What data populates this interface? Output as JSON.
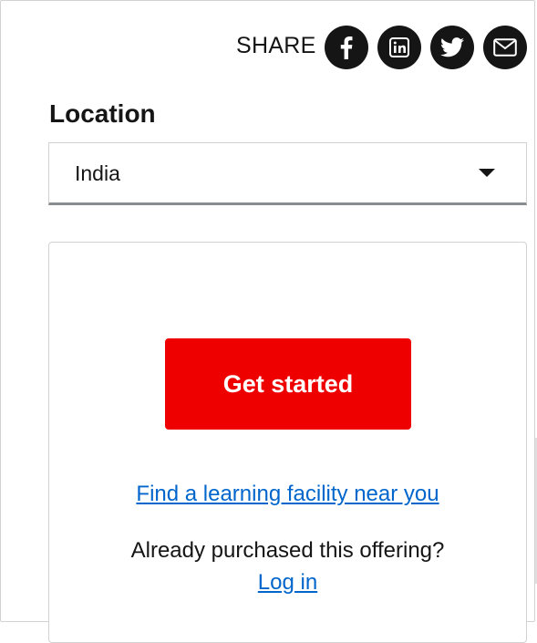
{
  "share": {
    "label": "SHARE",
    "buttons": [
      {
        "name": "facebook-share-button",
        "icon": "facebook-icon"
      },
      {
        "name": "linkedin-share-button",
        "icon": "linkedin-icon"
      },
      {
        "name": "twitter-share-button",
        "icon": "twitter-icon"
      },
      {
        "name": "email-share-button",
        "icon": "email-icon"
      }
    ]
  },
  "location": {
    "label": "Location",
    "selected": "India",
    "caret_icon": "caret-down-icon"
  },
  "card": {
    "cta_label": "Get started",
    "find_link": "Find a learning facility near you",
    "purchased_text": "Already purchased this offering?",
    "login_link": "Log in"
  },
  "colors": {
    "accent": "#ee0000",
    "link": "#0066cc",
    "text": "#151515",
    "share_button_bg": "#151515"
  }
}
